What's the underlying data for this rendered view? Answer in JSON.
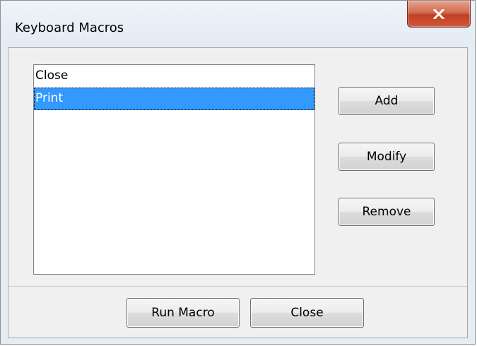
{
  "window": {
    "title": "Keyboard Macros",
    "close_icon": "close-x-icon"
  },
  "macros": {
    "items": [
      {
        "label": "Close",
        "selected": false
      },
      {
        "label": "Print",
        "selected": true
      }
    ]
  },
  "actions": {
    "add_label": "Add",
    "modify_label": "Modify",
    "remove_label": "Remove"
  },
  "footer": {
    "run_label": "Run Macro",
    "close_label": "Close"
  },
  "colors": {
    "selection": "#3399ff",
    "close_button": "#c74a2d"
  }
}
